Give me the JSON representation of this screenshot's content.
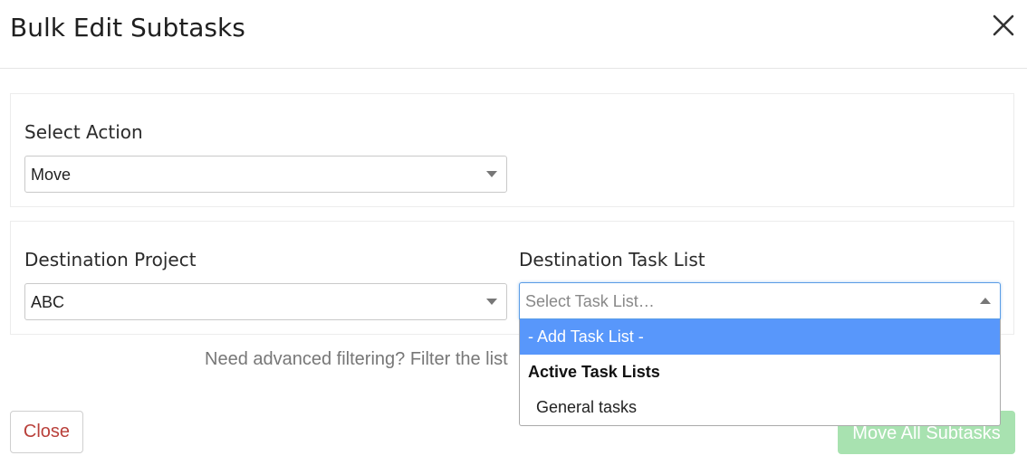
{
  "modal": {
    "title": "Bulk Edit Subtasks"
  },
  "action_panel": {
    "label": "Select Action",
    "selected": "Move"
  },
  "destination_panel": {
    "project_label": "Destination Project",
    "project_selected": "ABC",
    "task_list_label": "Destination Task List",
    "task_list_placeholder": "Select Task List…"
  },
  "task_list_dropdown": {
    "options": [
      {
        "label": "- Add Task List -",
        "highlighted": true
      },
      {
        "group": "Active Task Lists",
        "items": [
          "General tasks"
        ]
      }
    ]
  },
  "hint": {
    "text": "Need advanced filtering? Filter the list"
  },
  "footer": {
    "close_label": "Close",
    "move_label": "Move All Subtasks"
  },
  "colors": {
    "highlight": "#5897fb",
    "move_button": "#a8e2b0",
    "close_text": "#b9403a",
    "focus_border": "#5b9de6"
  },
  "icons": {
    "close": "close-icon",
    "caret": "chevron-down-icon"
  }
}
